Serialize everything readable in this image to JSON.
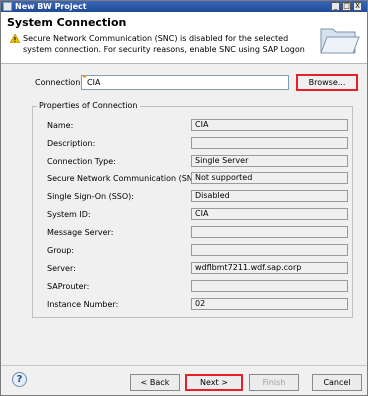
{
  "window": {
    "title": "New BW Project",
    "controls": {
      "minimize": "_",
      "maximize": "□",
      "close": "X"
    }
  },
  "header": {
    "title": "System Connection",
    "message": "Secure Network Communication (SNC) is disabled for the selected system connection. For security reasons, enable SNC using SAP Logon",
    "icons": {
      "warning": "warning-icon",
      "banner": "folder-icon"
    }
  },
  "connection": {
    "label": "Connection:",
    "value": "CIA",
    "browse_label": "Browse..."
  },
  "properties": {
    "group_label": "Properties of Connection",
    "rows": [
      {
        "label": "Name:",
        "value": "CIA"
      },
      {
        "label": "Description:",
        "value": ""
      },
      {
        "label": "Connection Type:",
        "value": "Single Server"
      },
      {
        "label": "Secure Network Communication (SNC):",
        "value": "Not supported"
      },
      {
        "label": "Single Sign-On (SSO):",
        "value": "Disabled"
      },
      {
        "label": "System ID:",
        "value": "CIA"
      },
      {
        "label": "Message Server:",
        "value": ""
      },
      {
        "label": "Group:",
        "value": ""
      },
      {
        "label": "Server:",
        "value": "wdflbmt7211.wdf.sap.corp"
      },
      {
        "label": "SAProuter:",
        "value": ""
      },
      {
        "label": "Instance Number:",
        "value": "02"
      }
    ]
  },
  "footer": {
    "help": "?",
    "back": "< Back",
    "next": "Next >",
    "finish": "Finish",
    "cancel": "Cancel"
  },
  "colors": {
    "highlight": "#e5202a",
    "title_bar": "#2a55a8"
  }
}
